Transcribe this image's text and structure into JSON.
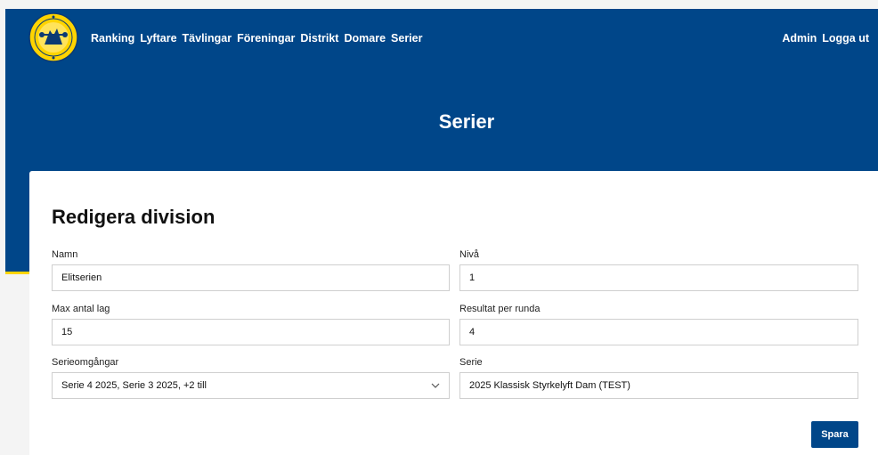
{
  "header": {
    "logo_name": "federation-logo",
    "nav": [
      "Ranking",
      "Lyftare",
      "Tävlingar",
      "Föreningar",
      "Distrikt",
      "Domare",
      "Serier"
    ],
    "right": [
      "Admin",
      "Logga ut"
    ],
    "title": "Serier"
  },
  "form": {
    "title": "Redigera division",
    "name": {
      "label": "Namn",
      "value": "Elitserien"
    },
    "level": {
      "label": "Nivå",
      "value": "1"
    },
    "max_teams": {
      "label": "Max antal lag",
      "value": "15"
    },
    "results_per_round": {
      "label": "Resultat per runda",
      "value": "4"
    },
    "rounds": {
      "label": "Serieomgångar",
      "value": "Serie 4 2025, Serie 3 2025, +2 till"
    },
    "series": {
      "label": "Serie",
      "value": "2025 Klassisk Styrkelyft Dam (TEST)"
    },
    "save_label": "Spara"
  },
  "colors": {
    "primary": "#004689",
    "accent": "#ffd400",
    "background": "#f4f4f4"
  }
}
